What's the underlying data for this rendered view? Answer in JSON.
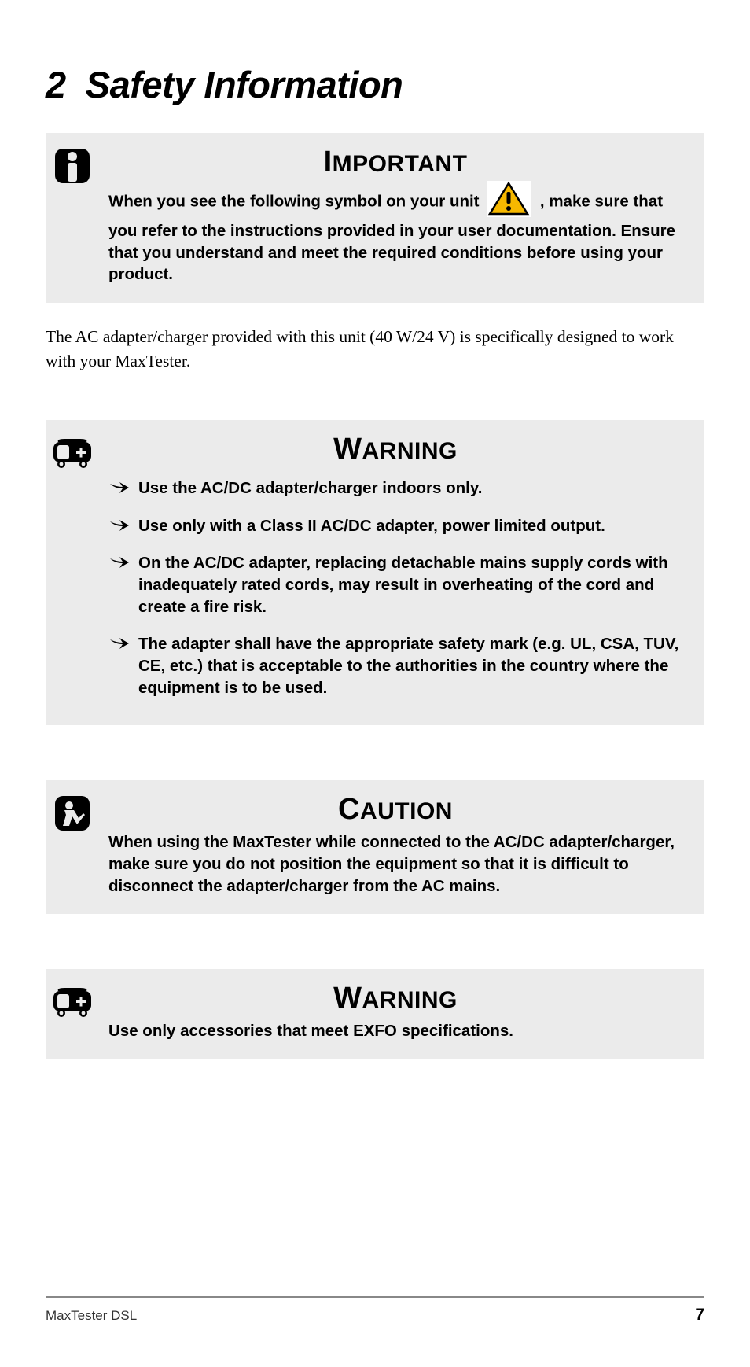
{
  "chapter": {
    "number": "2",
    "title": "Safety Information"
  },
  "important": {
    "heading": "IMPORTANT",
    "text_before": "When you see the following symbol on your unit",
    "text_after": ", make sure that you refer to the instructions provided in your user documentation. Ensure that you understand and meet the required conditions before using your product."
  },
  "body_paragraph": "The AC adapter/charger provided with this unit (40 W/24 V) is specifically designed to work with your MaxTester.",
  "warning1": {
    "heading": "WARNING",
    "items": [
      "Use the AC/DC adapter/charger indoors only.",
      "Use only with a Class II AC/DC adapter, power limited output.",
      "On the AC/DC adapter, replacing detachable mains supply cords with inadequately rated cords, may result in overheating of the cord and create a fire risk.",
      "The adapter shall have the appropriate safety mark (e.g. UL, CSA, TUV, CE, etc.) that is acceptable to the authorities in the country where the equipment is to be used."
    ]
  },
  "caution": {
    "heading": "CAUTION",
    "text": "When using the MaxTester while connected to the AC/DC adapter/charger, make sure you do not position the equipment so that it is difficult to disconnect the adapter/charger from the AC mains."
  },
  "warning2": {
    "heading": "WARNING",
    "text": "Use only accessories that meet EXFO specifications."
  },
  "footer": {
    "doc_name": "MaxTester DSL",
    "page_number": "7"
  }
}
